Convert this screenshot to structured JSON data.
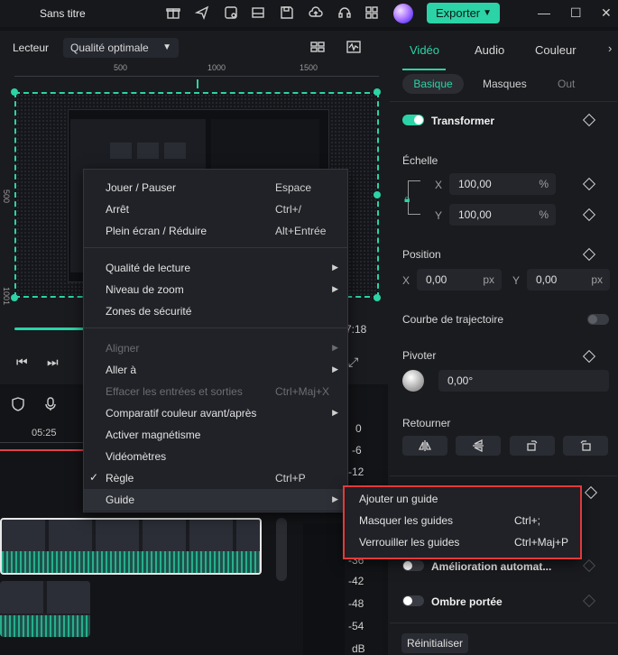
{
  "app": {
    "title": "Sans titre",
    "export_label": "Exporter"
  },
  "player": {
    "label": "Lecteur",
    "quality": "Qualité optimale",
    "ruler_ticks": [
      "500",
      "1000",
      "1500"
    ],
    "side_ticks": [
      "500",
      "1001"
    ],
    "time": "7:18"
  },
  "timeline": {
    "time_marker": "05:25",
    "meter_scale": [
      "0",
      "-6",
      "-12",
      "-36",
      "-42",
      "-48",
      "-54",
      "dB"
    ]
  },
  "panel": {
    "tabs": [
      "Vidéo",
      "Audio",
      "Couleur"
    ],
    "subtabs": [
      "Basique",
      "Masques",
      "Out"
    ],
    "transform": "Transformer",
    "scale": {
      "label": "Échelle",
      "x_label": "X",
      "x_value": "100,00",
      "y_label": "Y",
      "y_value": "100,00",
      "unit": "%"
    },
    "position": {
      "label": "Position",
      "x_label": "X",
      "x_value": "0,00",
      "y_label": "Y",
      "y_value": "0,00",
      "unit": "px"
    },
    "path_curve": "Courbe de trajectoire",
    "rotate": {
      "label": "Pivoter",
      "value": "0,00°"
    },
    "flip": "Retourner",
    "auto_enhance": "Amélioration automat...",
    "drop_shadow": "Ombre portée",
    "reset": "Réinitialiser"
  },
  "menu": {
    "items": [
      {
        "label": "Jouer / Pauser",
        "shortcut": "Espace"
      },
      {
        "label": "Arrêt",
        "shortcut": "Ctrl+/"
      },
      {
        "label": "Plein écran / Réduire",
        "shortcut": "Alt+Entrée"
      },
      {
        "label": "Qualité de lecture",
        "shortcut": ""
      },
      {
        "label": "Niveau de zoom",
        "shortcut": ""
      },
      {
        "label": "Zones de sécurité",
        "shortcut": ""
      },
      {
        "label": "Aligner",
        "shortcut": ""
      },
      {
        "label": "Aller à",
        "shortcut": ""
      },
      {
        "label": "Effacer les entrées et sorties",
        "shortcut": "Ctrl+Maj+X"
      },
      {
        "label": "Comparatif couleur avant/après",
        "shortcut": ""
      },
      {
        "label": "Activer magnétisme",
        "shortcut": ""
      },
      {
        "label": "Vidéomètres",
        "shortcut": ""
      },
      {
        "label": "Règle",
        "shortcut": "Ctrl+P"
      },
      {
        "label": "Guide",
        "shortcut": ""
      }
    ]
  },
  "submenu": {
    "items": [
      {
        "label": "Ajouter un guide",
        "shortcut": ""
      },
      {
        "label": "Masquer les guides",
        "shortcut": "Ctrl+;"
      },
      {
        "label": "Verrouiller les guides",
        "shortcut": "Ctrl+Maj+P"
      }
    ]
  },
  "colors": {
    "accent": "#2bd3a6",
    "highlight_box": "#e23a3a",
    "playhead": "#e1424a"
  }
}
